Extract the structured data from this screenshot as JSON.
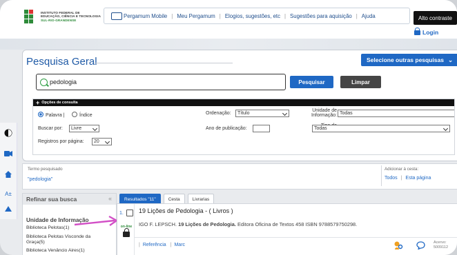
{
  "header": {
    "logo": {
      "line1": "INSTITUTO FEDERAL DE",
      "line2": "EDUCAÇÃO, CIÊNCIA E TECNOLOGIA",
      "line3": "SUL-RIO-GRANDENSE"
    },
    "nav": {
      "pergamum_mobile": "Pergamum Mobile",
      "meu_pergamum": "Meu Pergamum",
      "elogios": "Elogios, sugestões, etc",
      "sugestoes": "Sugestões para aquisição",
      "ajuda": "Ajuda"
    },
    "contrast_label": "Alto contraste",
    "login_label": "Login"
  },
  "accessibility": {
    "font_label": "A±"
  },
  "search": {
    "title": "Pesquisa Geral",
    "other_searches_label": "Selecione outras pesquisas",
    "query": "pedologia",
    "search_button": "Pesquisar",
    "clear_button": "Limpar",
    "options_title": "Opções de consulta",
    "radio_word": "Palavra",
    "radio_index": "Índice",
    "ordering_label": "Ordenação:",
    "ordering_value": "Título",
    "unit_label_line1": "Unidade de",
    "unit_label_line2": "Informação:",
    "unit_value": "Todas",
    "search_by_label": "Buscar por:",
    "search_by_value": "Livre",
    "pub_year_label": "Ano de publicação:",
    "pub_year_value": "",
    "work_type_label_line1": "Tipo de",
    "work_type_label_line2": "obra:",
    "work_type_value": "Todas",
    "per_page_label": "Registros por página:",
    "per_page_value": "20"
  },
  "termo": {
    "label": "Termo pesquisado",
    "value": "\"pedologia\"",
    "cart_label": "Adicionar à cesta:",
    "cart_all": "Todos",
    "cart_sep": "|",
    "cart_page": "Esta página"
  },
  "refine": {
    "title": "Refinar sua busca",
    "section_title": "Unidade de Informação",
    "libraries": [
      "Biblioteca Pelotas(1)",
      "Biblioteca Pelotas Visconde da Graça(5)",
      "Biblioteca Venâncio Aires(1)"
    ]
  },
  "results": {
    "tabs": [
      "Resultados \"11\"",
      "Cesta",
      "Livrarias"
    ],
    "items": [
      {
        "num": "1.",
        "title": "19 Lições de Pedologia - ( Livros )",
        "desc_author": "IGO F. LEPSCH.",
        "desc_title": "19 Lições de Pedologia.",
        "desc_rest": "Editora Oficina de Textos 458 ISBN 9788579750298.",
        "online": "on-line",
        "link_ref": "Referência",
        "link_sep": "|",
        "link_marc": "Marc",
        "acervo_label": "Acervo:",
        "acervo_value": "5009112"
      }
    ]
  },
  "colors": {
    "primary": "#1f68c4",
    "dark_button": "#454545",
    "green": "#2e8b3a",
    "annotation_arrow": "#d24fc6"
  }
}
